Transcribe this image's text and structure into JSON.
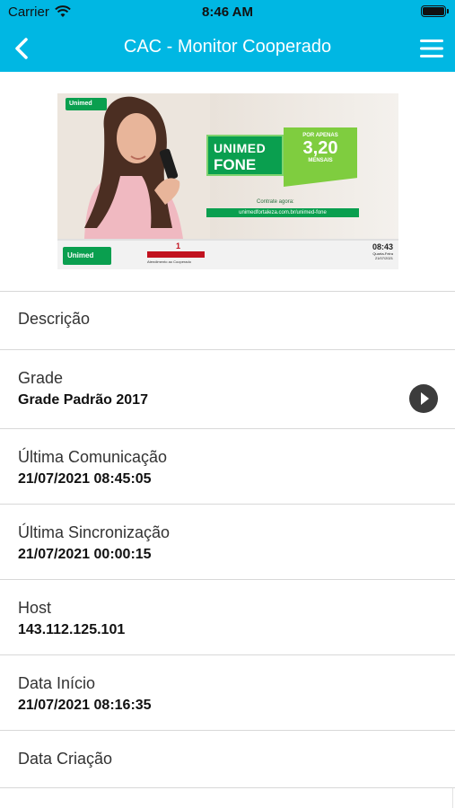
{
  "status": {
    "carrier": "Carrier",
    "time": "8:46 AM"
  },
  "nav": {
    "title": "CAC - Monitor Cooperado"
  },
  "media": {
    "logo": "Unimed",
    "promo_line1": "UNIMED",
    "promo_line2": "FONE",
    "price_top": "POR APENAS",
    "price": "3,20",
    "price_bottom": "MENSAIS",
    "cta": "Contrate agora:",
    "url": "unimedfortaleza.com.br/unimed-fone",
    "ticket_number": "1",
    "ticket_label": "Atendimento ao Cooperado",
    "clock_time": "08:43",
    "clock_day": "Quarta-Feira",
    "clock_date": "21/07/2021"
  },
  "fields": [
    {
      "label": "Descrição",
      "value": ""
    },
    {
      "label": "Grade",
      "value": "Grade Padrão 2017"
    },
    {
      "label": "Última Comunicação",
      "value": "21/07/2021 08:45:05"
    },
    {
      "label": "Última Sincronização",
      "value": "21/07/2021 00:00:15"
    },
    {
      "label": "Host",
      "value": "143.112.125.101"
    },
    {
      "label": "Data Início",
      "value": "21/07/2021 08:16:35"
    },
    {
      "label": "Data Criação",
      "value": ""
    }
  ],
  "colors": {
    "accent": "#00b7e3",
    "brand_green": "#0a9f4f",
    "price_green": "#7fcd3f"
  },
  "icons": {
    "back": "chevron-left-icon",
    "menu": "hamburger-menu-icon",
    "grade_action": "play-circle-icon",
    "wifi": "wifi-icon",
    "battery": "battery-icon"
  }
}
